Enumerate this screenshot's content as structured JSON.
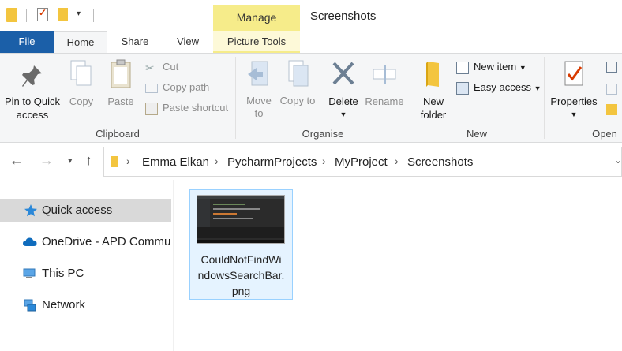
{
  "titlebar": {
    "manage_label": "Manage",
    "window_title": "Screenshots"
  },
  "tabs": {
    "file": "File",
    "home": "Home",
    "share": "Share",
    "view": "View",
    "picture_tools": "Picture Tools"
  },
  "ribbon": {
    "clipboard": {
      "pin": "Pin to Quick access",
      "copy": "Copy",
      "paste": "Paste",
      "cut": "Cut",
      "copy_path": "Copy path",
      "paste_shortcut": "Paste shortcut",
      "label": "Clipboard"
    },
    "organise": {
      "move_to": "Move to",
      "copy_to": "Copy to",
      "delete": "Delete",
      "rename": "Rename",
      "label": "Organise"
    },
    "new": {
      "new_folder": "New folder",
      "new_item": "New item",
      "easy_access": "Easy access",
      "label": "New"
    },
    "open": {
      "properties": "Properties",
      "label": "Open"
    }
  },
  "address": {
    "crumbs": [
      "Emma Elkan",
      "PycharmProjects",
      "MyProject",
      "Screenshots"
    ]
  },
  "nav_pane": {
    "items": [
      "Quick access",
      "OneDrive - APD Commun",
      "This PC",
      "Network"
    ]
  },
  "files": [
    {
      "name": "CouldNotFindWindowsSearchBar.png",
      "name_lines": [
        "CouldNotFindWi",
        "ndowsSearchBar.",
        "png"
      ]
    }
  ],
  "colors": {
    "file_tab": "#1b5fa8",
    "manage_highlight": "#f6ec8a",
    "selection": "#e5f3ff",
    "folder": "#f3c53f"
  }
}
